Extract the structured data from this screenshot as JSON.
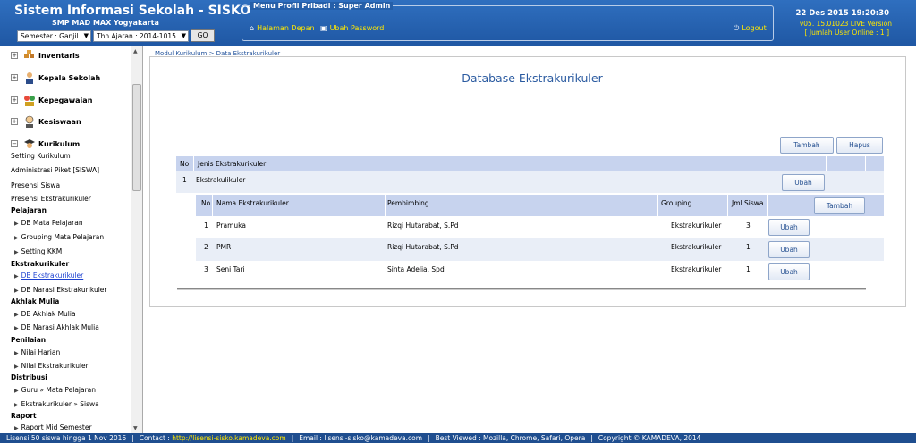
{
  "header": {
    "app_title": "Sistem Informasi Sekolah - SISKO",
    "school_name": "SMP MAD MAX Yogyakarta",
    "semester_select": "Semester : Ganjil",
    "year_select": "Thn Ajaran : 2014-1015",
    "go_label": "GO",
    "profile_title": "Menu Profil Pribadi : Super Admin",
    "home_link": "Halaman Depan",
    "password_link": "Ubah Password",
    "logout_link": "Logout",
    "datetime": "22 Des 2015 19:20:30",
    "version": "v05. 15.01023 LIVE Version",
    "online": "[ Jumlah User Online : 1 ]"
  },
  "sidebar": {
    "nodes": [
      "Inventaris",
      "Kepala Sekolah",
      "Kepegawaian",
      "Kesiswaan",
      "Kurikulum"
    ],
    "links": [
      "Setting Kurikulum",
      "Administrasi Piket [SISWA]",
      "Presensi Siswa",
      "Presensi Ekstrakurikuler"
    ],
    "groups": [
      {
        "title": "Pelajaran",
        "items": [
          "DB Mata Pelajaran",
          "Grouping Mata Pelajaran",
          "Setting KKM"
        ]
      },
      {
        "title": "Ekstrakurikuler",
        "items": [
          "DB Ekstrakurikuler",
          "DB Narasi Ekstrakurikuler"
        ]
      },
      {
        "title": "Akhlak Mulia",
        "items": [
          "DB Akhlak Mulia",
          "DB Narasi Akhlak Mulia"
        ]
      },
      {
        "title": "Penilaian",
        "items": [
          "Nilai Harian",
          "Nilai Ekstrakurikuler"
        ]
      },
      {
        "title": "Distribusi",
        "items": [
          "Guru » Mata Pelajaran",
          "Ekstrakurikuler » Siswa"
        ]
      },
      {
        "title": "Raport",
        "items": [
          "Raport Mid Semester"
        ]
      }
    ]
  },
  "main": {
    "breadcrumb": "Modul Kurikulum > Data Ekstrakurikuler",
    "title": "Database Ekstrakurikuler",
    "tambah_label": "Tambah",
    "hapus_label": "Hapus",
    "outer_headers": [
      "No",
      "Jenis Ekstrakurikuler"
    ],
    "outer_row": {
      "no": "1",
      "jenis": "Ekstrakulikuler",
      "ubah": "Ubah"
    },
    "inner_headers": [
      "No",
      "Nama Ekstrakurikuler",
      "Pembimbing",
      "Grouping",
      "Jml Siswa"
    ],
    "inner_tambah": "Tambah",
    "rows": [
      {
        "no": "1",
        "nama": "Pramuka",
        "pembimbing": "Rizqi Hutarabat, S.Pd",
        "grouping": "Ekstrakurikuler",
        "jml": "3",
        "ubah": "Ubah"
      },
      {
        "no": "2",
        "nama": "PMR",
        "pembimbing": "Rizqi Hutarabat, S.Pd",
        "grouping": "Ekstrakurikuler",
        "jml": "1",
        "ubah": "Ubah"
      },
      {
        "no": "3",
        "nama": "Seni Tari",
        "pembimbing": "Sinta Adelia, Spd",
        "grouping": "Ekstrakurikuler",
        "jml": "1",
        "ubah": "Ubah"
      }
    ]
  },
  "footer": {
    "license": "Lisensi 50 siswa hingga 1 Nov 2016",
    "contact_label": "Contact : ",
    "contact_url": "http://lisensi-sisko.kamadeva.com",
    "email": "Email : lisensi-sisko@kamadeva.com",
    "browsers": "Best Viewed : Mozilla, Chrome, Safari, Opera",
    "copyright": "Copyright © KAMADEVA, 2014"
  },
  "colors": {
    "header_bg": "#2463ad",
    "accent": "#ffe700",
    "table_header": "#c7d3ee",
    "title": "#2a5aa0"
  }
}
